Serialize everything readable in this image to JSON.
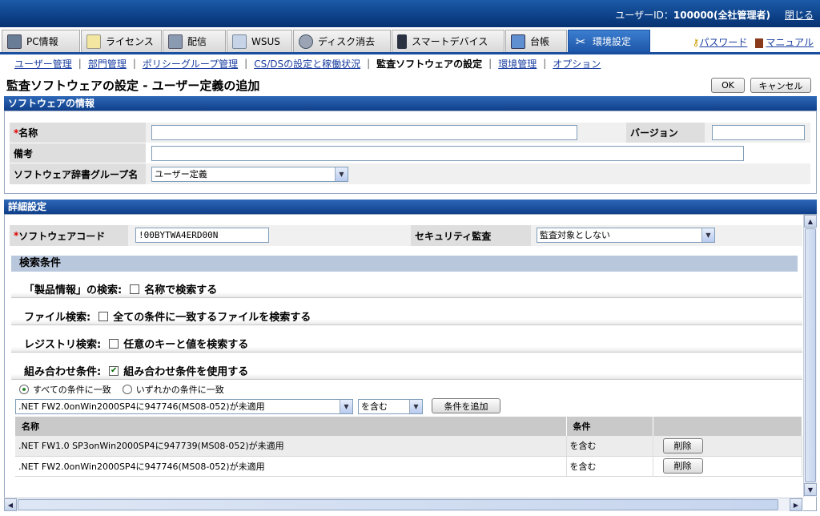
{
  "header": {
    "user_label": "ユーザーID：",
    "user_value": "100000(全社管理者)",
    "logout": "閉じる"
  },
  "tabs": [
    {
      "label": "PC情報",
      "icon": "pc-icon"
    },
    {
      "label": "ライセンス",
      "icon": "license-icon"
    },
    {
      "label": "配信",
      "icon": "delivery-icon"
    },
    {
      "label": "WSUS",
      "icon": "wsus-icon"
    },
    {
      "label": "ディスク消去",
      "icon": "disk-erase-icon"
    },
    {
      "label": "スマートデバイス",
      "icon": "smart-device-icon"
    },
    {
      "label": "台帳",
      "icon": "ledger-icon"
    },
    {
      "label": "環境設定",
      "icon": "settings-tools-icon"
    }
  ],
  "links": {
    "password": "パスワード",
    "manual": "マニュアル"
  },
  "subnav": [
    "ユーザー管理",
    "部門管理",
    "ポリシーグループ管理",
    "CS/DSの設定と稼働状況",
    "監査ソフトウェアの設定",
    "環境管理",
    "オプション"
  ],
  "page": {
    "title": "監査ソフトウェアの設定 - ユーザー定義の追加",
    "ok": "OK",
    "cancel": "キャンセル"
  },
  "software_info": {
    "heading": "ソフトウェアの情報",
    "name_label": "名称",
    "name_value": "",
    "version_label": "バージョン",
    "version_value": "",
    "note_label": "備考",
    "note_value": "",
    "dict_group_label": "ソフトウェア辞書グループ名",
    "dict_group_value": "ユーザー定義"
  },
  "details": {
    "heading": "詳細設定",
    "code_label": "ソフトウェアコード",
    "code_value": "!00BYTWA4ERD00N",
    "security_label": "セキュリティ監査",
    "security_value": "監査対象としない",
    "search_heading": "検索条件",
    "product_search_label": "「製品情報」の検索:",
    "product_search_option": "名称で検索する",
    "file_search_label": "ファイル検索:",
    "file_search_option": "全ての条件に一致するファイルを検索する",
    "registry_search_label": "レジストリ検索:",
    "registry_search_option": "任意のキーと値を検索する",
    "combo_label": "組み合わせ条件:",
    "combo_option": "組み合わせ条件を使用する",
    "radio_all": "すべての条件に一致",
    "radio_any": "いずれかの条件に一致",
    "condition_select": ".NET FW2.0onWin2000SP4に947746(MS08-052)が未適用",
    "op_select": "を含む",
    "add_button": "条件を追加",
    "table_headers": [
      "名称",
      "条件",
      ""
    ],
    "rows": [
      {
        "name": ".NET FW1.0 SP3onWin2000SP4に947739(MS08-052)が未適用",
        "cond": "を含む",
        "action": "削除"
      },
      {
        "name": ".NET FW2.0onWin2000SP4に947746(MS08-052)が未適用",
        "cond": "を含む",
        "action": "削除"
      }
    ]
  },
  "colors": {
    "header_blue": "#0b3d82",
    "active_tab": "#1d56a8",
    "link": "#1a3ea0",
    "required": "#dd0000"
  }
}
